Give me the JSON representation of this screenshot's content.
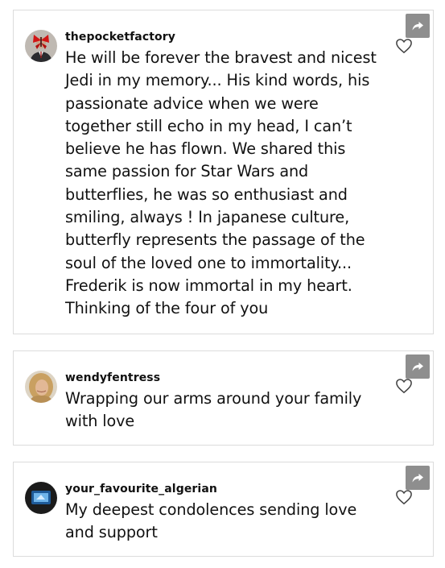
{
  "comments": [
    {
      "username": "thepocketfactory",
      "text": "He will be forever the bravest and nicest Jedi in my memory... His kind words, his passionate advice when we were together still echo in my head, I can’t believe he has flown. We shared this same passion for Star Wars and butterflies, he was so enthusiast and smiling, always ! In japanese culture, butterfly represents the passage of the soul of the loved one to immortality... Frederik is now immortal in my heart. Thinking of the four of you",
      "avatar_icon": "suited-man-red-butterfly-avatar",
      "share_icon": "share-arrow-icon",
      "like_icon": "heart-outline-icon"
    },
    {
      "username": "wendyfentress",
      "text": "Wrapping our arms around your family with love",
      "avatar_icon": "blonde-woman-avatar",
      "share_icon": "share-arrow-icon",
      "like_icon": "heart-outline-icon"
    },
    {
      "username": "your_favourite_algerian",
      "text": "My deepest condolences sending love and support",
      "avatar_icon": "blue-screen-avatar",
      "share_icon": "share-arrow-icon",
      "like_icon": "heart-outline-icon"
    }
  ],
  "colors": {
    "share_button_bg": "#8e8e8e",
    "card_border": "#dcdcdc",
    "text": "#111111"
  }
}
